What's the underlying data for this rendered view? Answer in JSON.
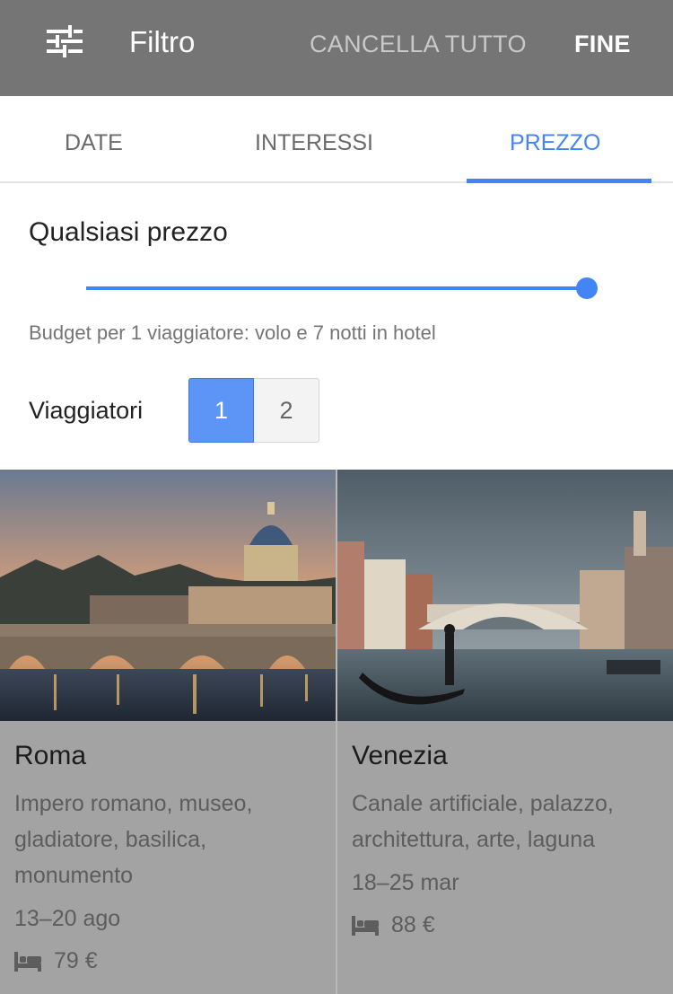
{
  "header": {
    "title": "Filtro",
    "clear_all": "CANCELLA TUTTO",
    "done": "FINE",
    "icon": "filter-sliders-icon"
  },
  "tabs": [
    {
      "label": "DATE",
      "active": false
    },
    {
      "label": "INTERESSI",
      "active": false
    },
    {
      "label": "PREZZO",
      "active": true
    }
  ],
  "price_filter": {
    "title": "Qualsiasi prezzo",
    "slider_level": 1.0,
    "budget_note": "Budget per 1 viaggiatore: volo e 7 notti in hotel",
    "travelers_label": "Viaggiatori",
    "travelers_options": [
      "1",
      "2"
    ],
    "travelers_selected": "1"
  },
  "destinations": [
    {
      "city": "Roma",
      "tags": "Impero romano, museo, gladiatore, basilica, monumento",
      "dates": "13–20 ago",
      "price": "79 €",
      "price_icon": "hotel-bed-icon"
    },
    {
      "city": "Venezia",
      "tags": "Canale artificiale, palazzo, architettura, arte, laguna",
      "dates": "18–25 mar",
      "price": "88 €",
      "price_icon": "hotel-bed-icon"
    }
  ],
  "colors": {
    "accent": "#4285f4",
    "header_bg": "#757575",
    "card_bg": "#a3a3a3"
  }
}
